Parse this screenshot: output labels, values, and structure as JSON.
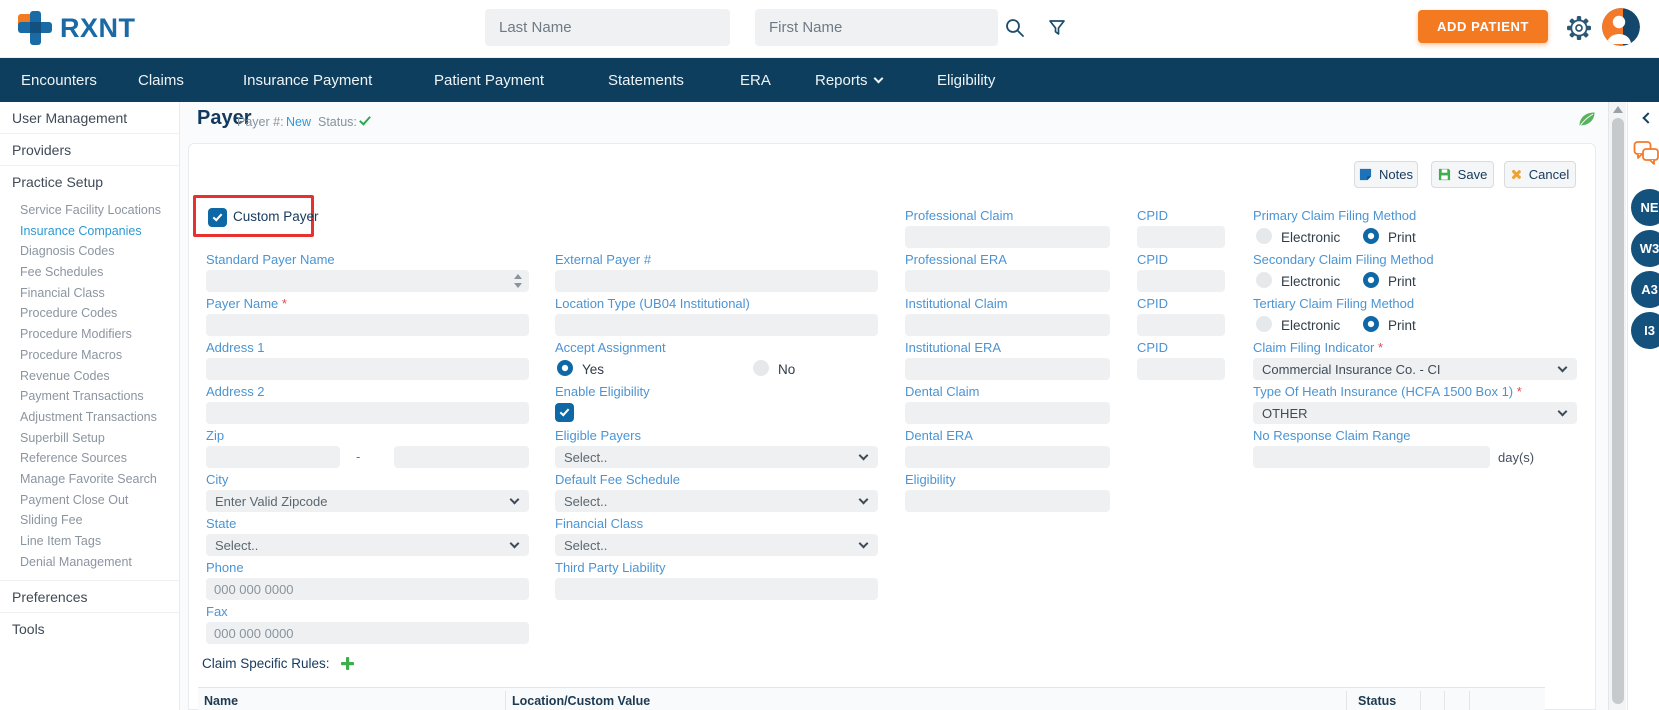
{
  "header": {
    "logo": "RXNT",
    "search": {
      "last_name_placeholder": "Last Name",
      "first_name_placeholder": "First Name"
    },
    "add_patient": "ADD PATIENT"
  },
  "nav": {
    "items": [
      "Encounters",
      "Claims",
      "Insurance Payment",
      "Patient Payment",
      "Statements",
      "ERA",
      "Reports",
      "Eligibility"
    ]
  },
  "sidebar": {
    "user_management": "User Management",
    "providers": "Providers",
    "practice_setup": "Practice Setup",
    "practice_items": [
      "Service Facility Locations",
      "Insurance Companies",
      "Diagnosis Codes",
      "Fee Schedules",
      "Financial Class",
      "Procedure Codes",
      "Procedure Modifiers",
      "Procedure Macros",
      "Revenue Codes",
      "Payment Transactions",
      "Adjustment Transactions",
      "Superbill Setup",
      "Reference Sources",
      "Manage Favorite Search",
      "Payment Close Out",
      "Sliding Fee",
      "Line Item Tags",
      "Denial Management"
    ],
    "active_item": "Insurance Companies",
    "preferences": "Preferences",
    "tools": "Tools"
  },
  "page": {
    "title": "Payer",
    "payer_number_label": "Payer #:",
    "payer_number_value": "New",
    "status_label": "Status:",
    "buttons": {
      "notes": "Notes",
      "save": "Save",
      "cancel": "Cancel"
    }
  },
  "form": {
    "custom_payer": "Custom Payer",
    "required_marker": "*",
    "col1": {
      "standard_payer_name": "Standard Payer Name",
      "payer_name": "Payer Name",
      "address1": "Address 1",
      "address2": "Address 2",
      "zip": "Zip",
      "zip_dash": "-",
      "city": "City",
      "city_value": "Enter Valid Zipcode",
      "state": "State",
      "state_value": "Select..",
      "phone": "Phone",
      "phone_placeholder": "000 000 0000",
      "fax": "Fax",
      "fax_placeholder": "000 000 0000"
    },
    "col2": {
      "external_payer": "External Payer #",
      "location_type": "Location Type (UB04 Institutional)",
      "accept_assignment": "Accept Assignment",
      "yes": "Yes",
      "no": "No",
      "enable_eligibility": "Enable Eligibility",
      "eligible_payers": "Eligible Payers",
      "default_fee_schedule": "Default Fee Schedule",
      "financial_class": "Financial Class",
      "third_party_liability": "Third Party Liability",
      "select_placeholder": "Select.."
    },
    "col3": {
      "rows": [
        {
          "label": "Professional Claim",
          "cpid": "CPID"
        },
        {
          "label": "Professional ERA",
          "cpid": "CPID"
        },
        {
          "label": "Institutional Claim",
          "cpid": "CPID"
        },
        {
          "label": "Institutional ERA",
          "cpid": "CPID"
        },
        {
          "label": "Dental Claim"
        },
        {
          "label": "Dental ERA"
        },
        {
          "label": "Eligibility"
        }
      ]
    },
    "col4": {
      "primary": "Primary Claim Filing Method",
      "secondary": "Secondary Claim Filing Method",
      "tertiary": "Tertiary Claim Filing Method",
      "electronic": "Electronic",
      "print": "Print",
      "claim_filing_indicator": "Claim Filing Indicator",
      "claim_filing_indicator_value": "Commercial Insurance Co. - CI",
      "type_of_health_insurance": "Type Of Heath Insurance (HCFA 1500 Box 1)",
      "type_of_health_insurance_value": "OTHER",
      "no_response_claim_range": "No Response Claim Range",
      "days_suffix": "day(s)"
    }
  },
  "rules": {
    "title": "Claim Specific Rules:",
    "table_headers": [
      "Name",
      "Location/Custom Value",
      "Status"
    ]
  },
  "right_panel": {
    "badges": [
      "NE",
      "W3",
      "A3",
      "I3"
    ]
  },
  "colors": {
    "brand_orange": "#f47a22",
    "nav_navy": "#0e3e5e",
    "label_blue": "#4b94d3",
    "active_blue": "#2d9ad3",
    "control_blue": "#0e68a6",
    "success_green": "#36a84c",
    "highlight_red": "#e8312e",
    "badge_navy": "#14527d"
  }
}
